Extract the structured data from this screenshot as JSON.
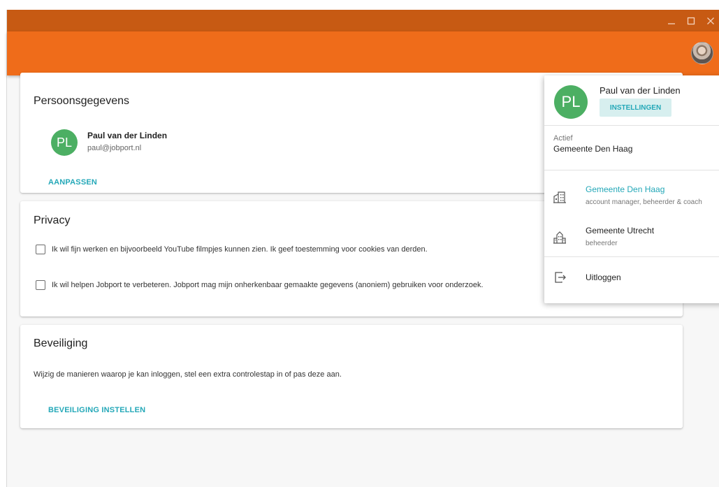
{
  "window": {
    "controls": {
      "minimize": "_",
      "maximize": "☐",
      "close": "✕"
    }
  },
  "colors": {
    "titlebar": "#c75a13",
    "appbar": "#ef6c1a",
    "accent": "#24a8b8",
    "avatar_bg": "#4caf63"
  },
  "profile_card": {
    "title": "Persoonsgegevens",
    "avatar_initials": "PL",
    "name": "Paul van der Linden",
    "email": "paul@jobport.nl",
    "edit_button": "AANPASSEN"
  },
  "privacy_card": {
    "title": "Privacy",
    "options": [
      {
        "label": "Ik wil fijn werken en bijvoorbeeld YouTube filmpjes kunnen zien. Ik geef toestemming voor cookies van derden.",
        "checked": false
      },
      {
        "label": "Ik wil helpen Jobport te verbeteren. Jobport mag mijn onherkenbaar gemaakte gegevens (anoniem) gebruiken voor onderzoek.",
        "checked": false
      }
    ]
  },
  "security_card": {
    "title": "Beveiliging",
    "description": "Wijzig de manieren waarop je kan inloggen, stel een extra controlestap in of pas deze aan.",
    "button": "BEVEILIGING INSTELLEN"
  },
  "account_menu": {
    "avatar_initials": "PL",
    "name": "Paul van der Linden",
    "settings_button": "INSTELLINGEN",
    "active_label": "Actief",
    "active_org": "Gemeente Den Haag",
    "organizations": [
      {
        "name": "Gemeente Den Haag",
        "roles": "account manager, beheerder & coach",
        "icon": "office-building-icon",
        "selected": true
      },
      {
        "name": "Gemeente Utrecht",
        "roles": "beheerder",
        "icon": "city-building-icon",
        "selected": false
      }
    ],
    "logout": {
      "label": "Uitloggen",
      "icon": "logout-icon"
    }
  }
}
